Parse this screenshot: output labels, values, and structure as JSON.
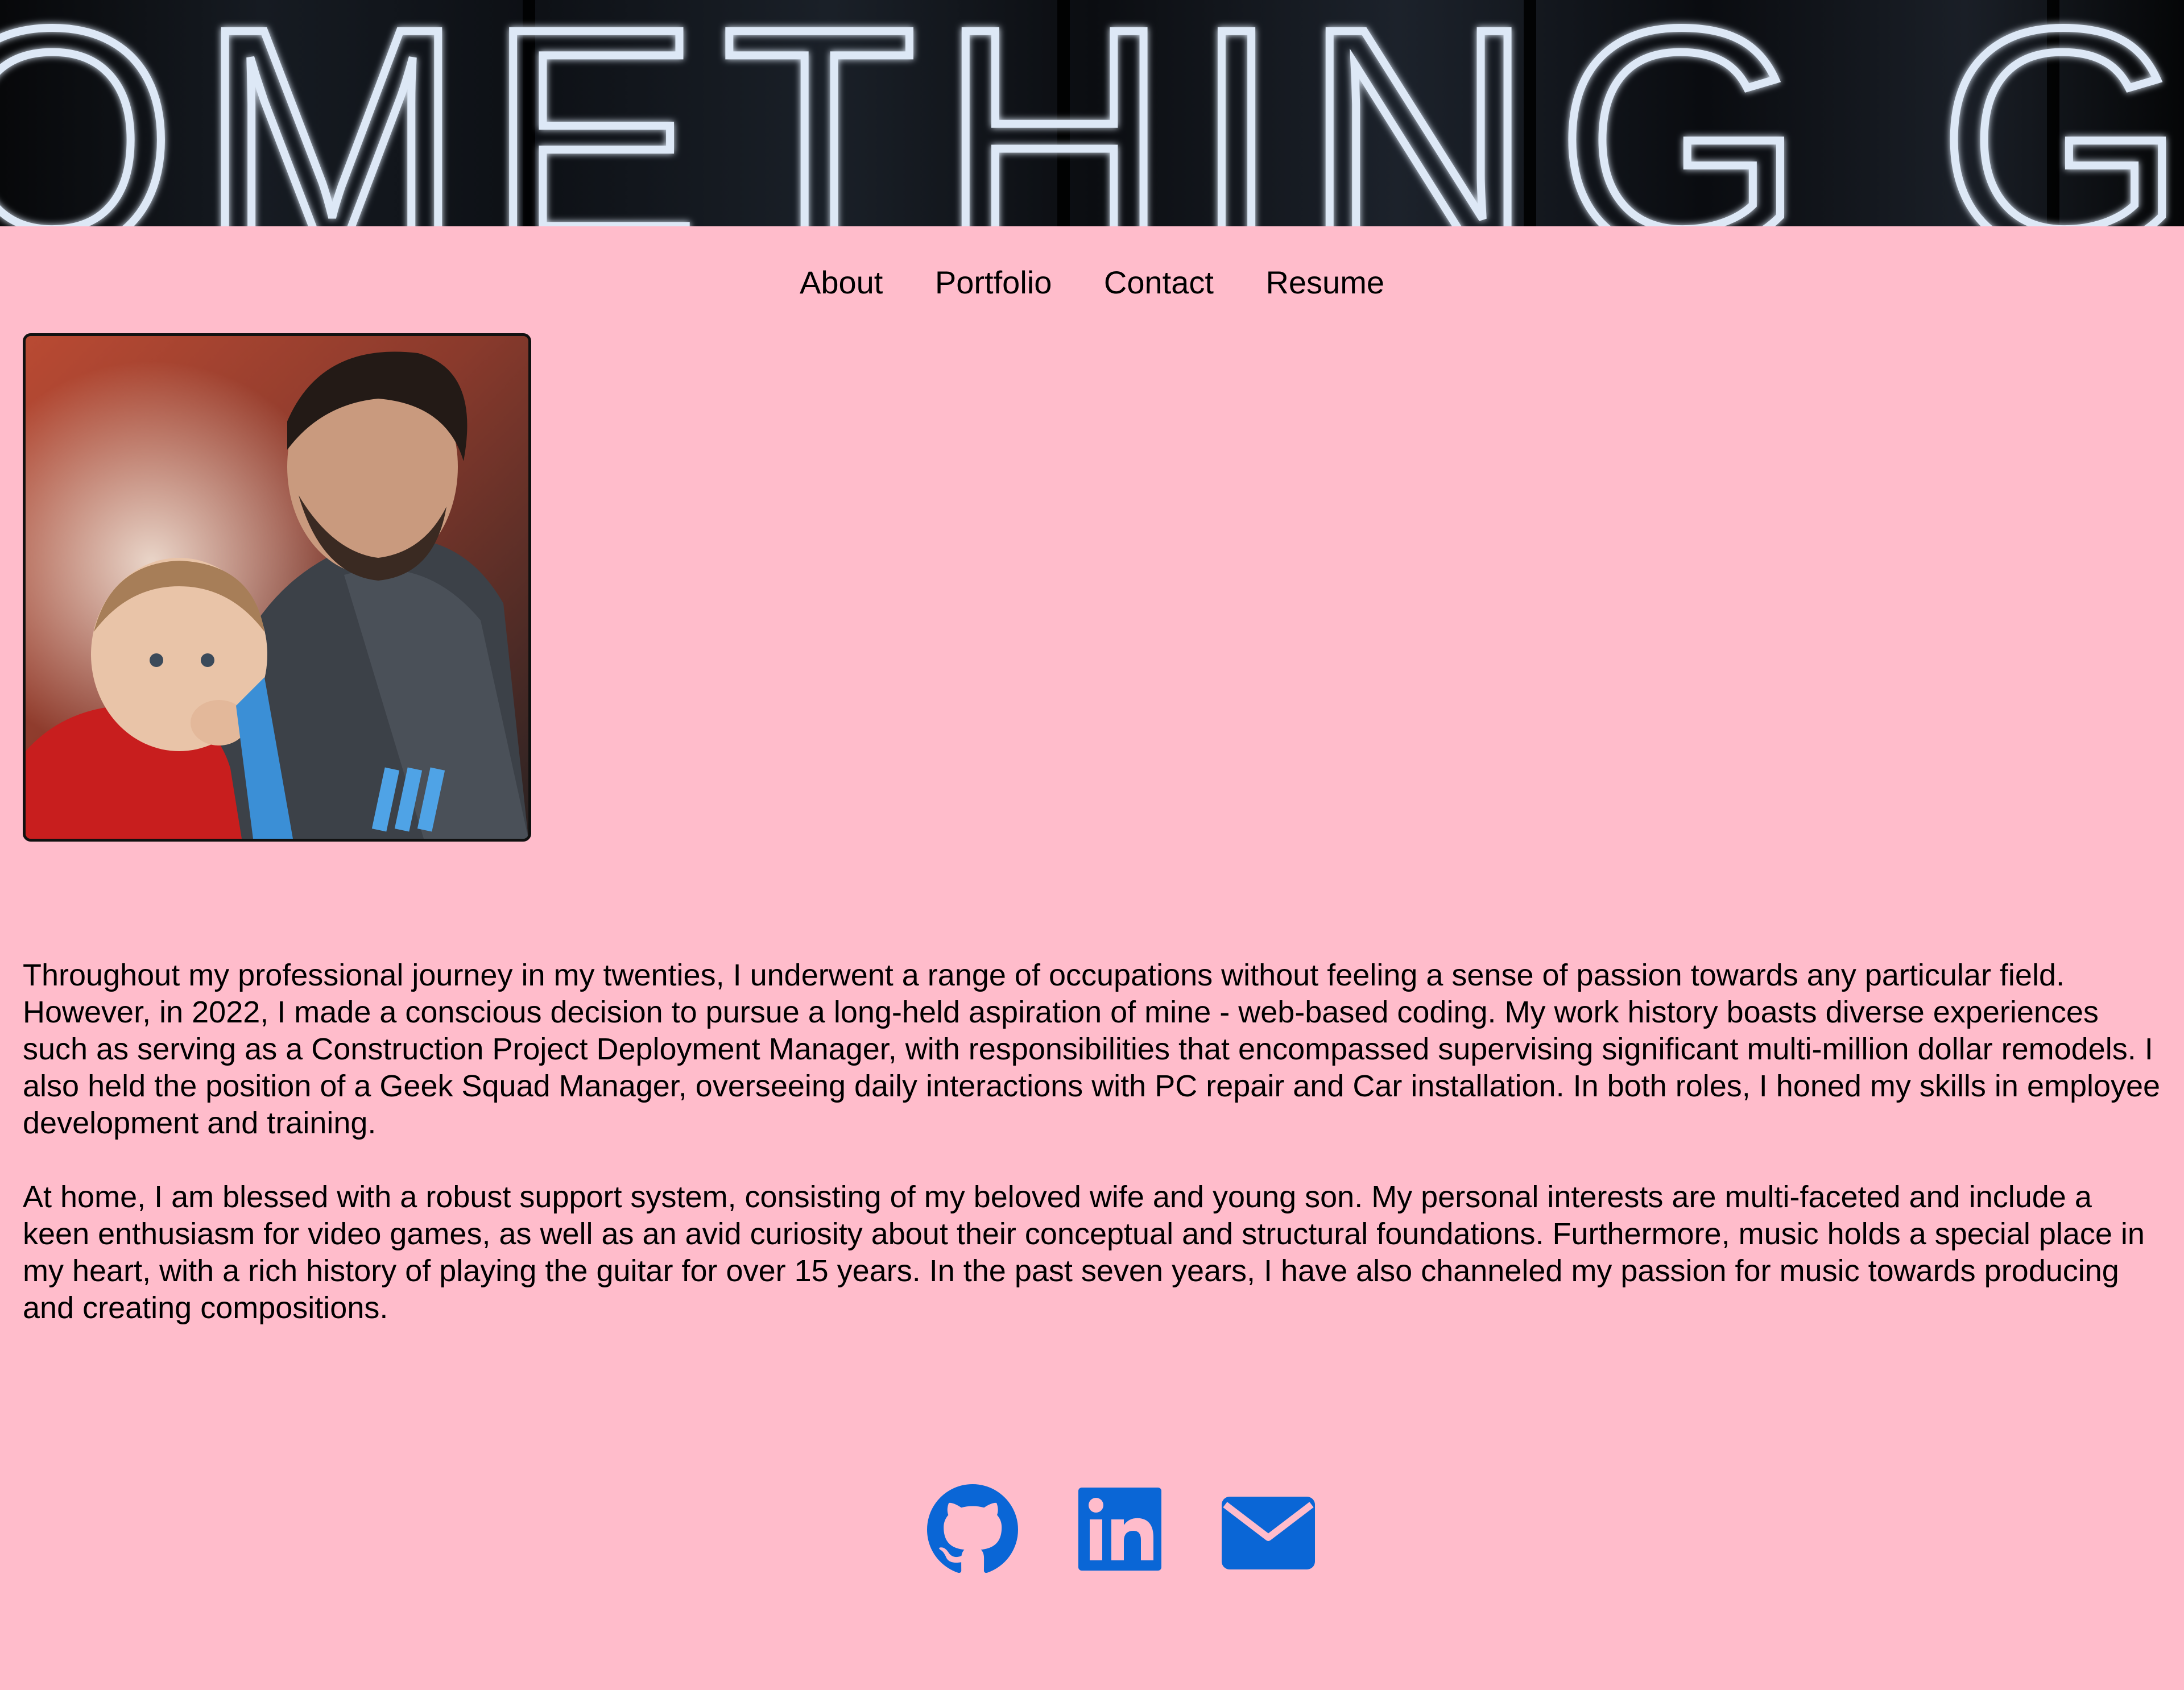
{
  "header": {
    "banner_text": "DO SOMETHING GREAT"
  },
  "nav": {
    "items": [
      {
        "label": "About"
      },
      {
        "label": "Portfolio"
      },
      {
        "label": "Contact"
      },
      {
        "label": "Resume"
      }
    ]
  },
  "bio": {
    "paragraphs": [
      "Throughout my professional journey in my twenties, I underwent a range of occupations without feeling a sense of passion towards any particular field. However, in 2022, I made a conscious decision to pursue a long-held aspiration of mine - web-based coding. My work history boasts diverse experiences such as serving as a Construction Project Deployment Manager, with responsibilities that encompassed supervising significant multi-million dollar remodels. I also held the position of a Geek Squad Manager, overseeing daily interactions with PC repair and Car installation. In both roles, I honed my skills in employee development and training.",
      "At home, I am blessed with a robust support system, consisting of my beloved wife and young son. My personal interests are multi-faceted and include a keen enthusiasm for video games, as well as an avid curiosity about their conceptual and structural foundations. Furthermore, music holds a special place in my heart, with a rich history of playing the guitar for over 15 years. In the past seven years, I have also channeled my passion for music towards producing and creating compositions."
    ]
  },
  "social": {
    "icons": [
      "github-icon",
      "linkedin-icon",
      "email-icon"
    ]
  },
  "colors": {
    "background": "#ffbccb",
    "icon_blue": "#0a66d6",
    "text": "#000000"
  }
}
